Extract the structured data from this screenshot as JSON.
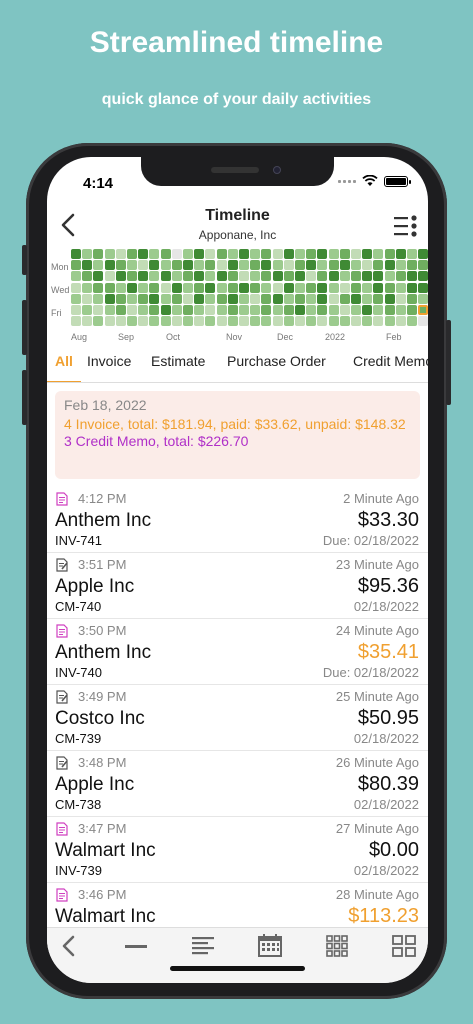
{
  "promo": {
    "title": "Streamlined timeline",
    "subtitle": "quick glance of your daily activities"
  },
  "status_bar": {
    "time": "4:14"
  },
  "nav": {
    "title": "Timeline",
    "subtitle": "Apponane, Inc"
  },
  "heatmap": {
    "day_labels": [
      "Mon",
      "Wed",
      "Fri"
    ],
    "month_labels": [
      "Aug",
      "Sep",
      "Oct",
      "Nov",
      "Dec",
      "2022",
      "Feb"
    ],
    "colors": [
      "#e6e6e6",
      "#c2dcb6",
      "#9ccb8e",
      "#6fae5f",
      "#3f8a34"
    ],
    "highlight_color": "#f0a030",
    "levels": [
      [
        4,
        2,
        3,
        2,
        1,
        3,
        4,
        2,
        3,
        0,
        2,
        4,
        1,
        3,
        2,
        4,
        2,
        3,
        1,
        4,
        2,
        3,
        4,
        2,
        3,
        1,
        4,
        2,
        3,
        4,
        2,
        4
      ],
      [
        3,
        4,
        2,
        4,
        3,
        2,
        1,
        4,
        2,
        3,
        4,
        2,
        3,
        1,
        4,
        2,
        3,
        4,
        2,
        1,
        3,
        4,
        2,
        3,
        4,
        2,
        1,
        3,
        4,
        2,
        3,
        3
      ],
      [
        2,
        3,
        4,
        1,
        4,
        3,
        4,
        2,
        4,
        2,
        3,
        4,
        2,
        4,
        3,
        1,
        2,
        3,
        4,
        3,
        4,
        1,
        3,
        4,
        2,
        3,
        4,
        4,
        2,
        3,
        4,
        4
      ],
      [
        1,
        2,
        3,
        3,
        2,
        4,
        2,
        3,
        1,
        4,
        2,
        3,
        4,
        2,
        3,
        4,
        3,
        2,
        1,
        4,
        2,
        3,
        4,
        2,
        1,
        3,
        2,
        4,
        3,
        2,
        4,
        4
      ],
      [
        2,
        1,
        2,
        4,
        3,
        2,
        3,
        4,
        2,
        3,
        1,
        4,
        2,
        3,
        4,
        2,
        1,
        3,
        4,
        2,
        3,
        2,
        4,
        1,
        3,
        4,
        2,
        3,
        4,
        1,
        3,
        2
      ],
      [
        1,
        2,
        1,
        2,
        3,
        1,
        2,
        3,
        4,
        2,
        3,
        2,
        1,
        2,
        3,
        2,
        2,
        3,
        2,
        3,
        4,
        2,
        3,
        2,
        1,
        2,
        4,
        2,
        3,
        2,
        3,
        9
      ],
      [
        1,
        1,
        2,
        1,
        1,
        2,
        1,
        2,
        2,
        1,
        2,
        1,
        2,
        1,
        2,
        1,
        2,
        2,
        1,
        2,
        1,
        2,
        1,
        2,
        2,
        1,
        2,
        1,
        2,
        1,
        2,
        0
      ]
    ]
  },
  "tabs": [
    "All",
    "Invoice",
    "Estimate",
    "Purchase Order",
    "Credit Memo"
  ],
  "summary": {
    "date": "Feb 18, 2022",
    "invoice_line": "4 Invoice, total: $181.94, paid: $33.62, unpaid: $148.32",
    "credit_line": "3 Credit Memo, total: $226.70"
  },
  "entries": [
    {
      "type": "invoice",
      "time": "4:12 PM",
      "ago": "2 Minute Ago",
      "name": "Anthem Inc",
      "amount": "$33.30",
      "amount_color": "default",
      "number": "INV-741",
      "due": "Due: 02/18/2022"
    },
    {
      "type": "credit",
      "time": "3:51 PM",
      "ago": "23 Minute Ago",
      "name": "Apple Inc",
      "amount": "$95.36",
      "amount_color": "default",
      "number": "CM-740",
      "due": "02/18/2022"
    },
    {
      "type": "invoice",
      "time": "3:50 PM",
      "ago": "24 Minute Ago",
      "name": "Anthem Inc",
      "amount": "$35.41",
      "amount_color": "orange",
      "number": "INV-740",
      "due": "Due: 02/18/2022"
    },
    {
      "type": "credit",
      "time": "3:49 PM",
      "ago": "25 Minute Ago",
      "name": "Costco Inc",
      "amount": "$50.95",
      "amount_color": "default",
      "number": "CM-739",
      "due": "02/18/2022"
    },
    {
      "type": "credit",
      "time": "3:48 PM",
      "ago": "26 Minute Ago",
      "name": "Apple Inc",
      "amount": "$80.39",
      "amount_color": "default",
      "number": "CM-738",
      "due": "02/18/2022"
    },
    {
      "type": "invoice",
      "time": "3:47 PM",
      "ago": "27 Minute Ago",
      "name": "Walmart Inc",
      "amount": "$0.00",
      "amount_color": "default",
      "number": "INV-739",
      "due": "02/18/2022"
    },
    {
      "type": "invoice",
      "time": "3:46 PM",
      "ago": "28 Minute Ago",
      "name": "Walmart Inc",
      "amount": "$113.23",
      "amount_color": "orange",
      "number": "",
      "due": ""
    }
  ],
  "toolbar_icons": [
    "back-icon",
    "minus-icon",
    "list-lines-icon",
    "calendar-icon",
    "grid-small-icon",
    "grid-large-icon"
  ]
}
